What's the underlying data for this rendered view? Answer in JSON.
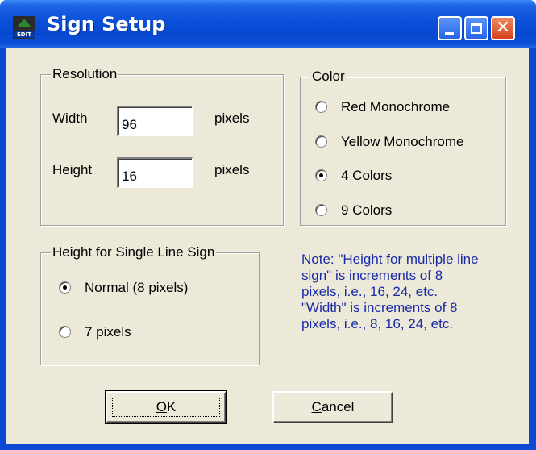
{
  "window": {
    "title": "Sign Setup",
    "icon_text": "EDIT"
  },
  "resolution": {
    "group_label": "Resolution",
    "width_label": "Width",
    "width_value": "96",
    "width_unit": "pixels",
    "height_label": "Height",
    "height_value": "16",
    "height_unit": "pixels"
  },
  "color": {
    "group_label": "Color",
    "options": [
      {
        "label": "Red Monochrome",
        "selected": false
      },
      {
        "label": "Yellow Monochrome",
        "selected": false
      },
      {
        "label": "4 Colors",
        "selected": true
      },
      {
        "label": "9 Colors",
        "selected": false
      }
    ]
  },
  "single_line": {
    "group_label": "Height for Single Line Sign",
    "options": [
      {
        "label": "Normal (8 pixels)",
        "selected": true
      },
      {
        "label": "7 pixels",
        "selected": false
      }
    ]
  },
  "note": {
    "lines": [
      "Note: \"Height for multiple line",
      "sign\" is increments of 8",
      "pixels, i.e., 16, 24, etc.",
      "\"Width\" is increments of 8",
      "pixels, i.e., 8, 16, 24, etc."
    ]
  },
  "buttons": {
    "ok_mnemonic": "O",
    "ok_rest": "K",
    "cancel_mnemonic": "C",
    "cancel_rest": "ancel"
  }
}
